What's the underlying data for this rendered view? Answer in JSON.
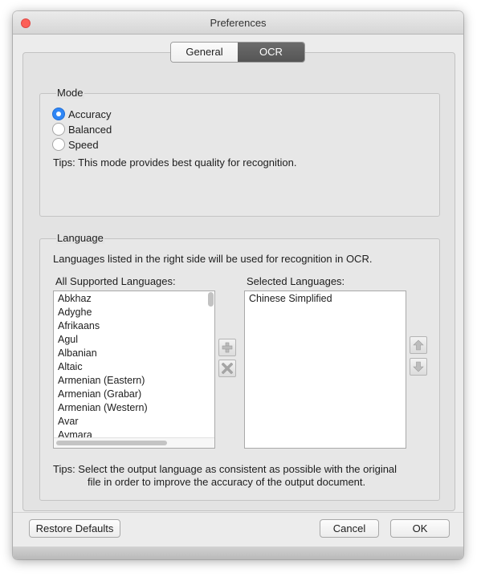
{
  "window": {
    "title": "Preferences"
  },
  "tabs": [
    {
      "label": "General",
      "active": false
    },
    {
      "label": "OCR",
      "active": true
    }
  ],
  "mode": {
    "title": "Mode",
    "options": [
      {
        "label": "Accuracy",
        "checked": true
      },
      {
        "label": "Balanced",
        "checked": false
      },
      {
        "label": "Speed",
        "checked": false
      }
    ],
    "tips": "Tips:  This mode provides best quality for recognition."
  },
  "language": {
    "title": "Language",
    "description": "Languages listed in the right side will be used for recognition in OCR.",
    "all_label": "All Supported Languages:",
    "selected_label": "Selected Languages:",
    "all_languages": [
      "Abkhaz",
      "Adyghe",
      "Afrikaans",
      "Agul",
      "Albanian",
      "Altaic",
      "Armenian (Eastern)",
      "Armenian (Grabar)",
      "Armenian (Western)",
      "Avar",
      "Aymara"
    ],
    "selected_languages": [
      "Chinese Simplified"
    ],
    "tips_line1": "Tips:   Select the output language as consistent as possible with the original",
    "tips_line2": "file in order to improve the accuracy of the output document."
  },
  "icons": {
    "add": "plus-icon",
    "remove": "x-icon",
    "move_up": "arrow-up-icon",
    "move_down": "arrow-down-icon"
  },
  "buttons": {
    "restore": "Restore Defaults",
    "cancel": "Cancel",
    "ok": "OK"
  },
  "colors": {
    "accent": "#2f86f5",
    "close": "#fc5f57",
    "active_tab": "#5e5e5e"
  }
}
